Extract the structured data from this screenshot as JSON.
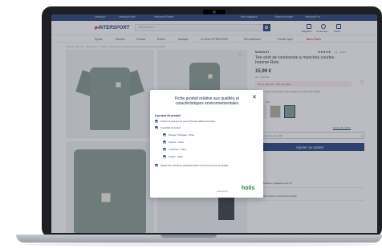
{
  "topbar": {
    "items": [
      "Intersport",
      "Intersport Rent",
      "Intersport Fitness",
      "Mes magasins",
      "Espace membre",
      "Intersport Pro"
    ]
  },
  "header": {
    "logo_text": "INTERSPORT",
    "search_placeholder": "Rechercher...",
    "links": [
      "Magasins",
      "Connexion",
      "Panier"
    ]
  },
  "nav": {
    "items": [
      "Sports",
      "Homme",
      "Femme",
      "Enfant",
      "Marques",
      "Le Team INTERSPORT",
      "Reconditionné",
      "French Days",
      "Bons Plans"
    ]
  },
  "breadcrumb": "Accueil > Homme > Vêtements > T-shirts > Tee-shirt de randonnée à manches courtes homme Relo",
  "product": {
    "brand": "McKINLEY",
    "stars": "★★★★★",
    "reviews": "4.1 · 3 avis",
    "title": "Tee-shirt de randonnée à manches courtes homme Relo",
    "price": "15,99 €",
    "reference": "Réf : 4005290",
    "promo": "Prix le plus bas : Prix Conseillé",
    "payment": "Payez en 3 fois sans frais par carte bancaire dès 100 € avec PayPal",
    "color_label": "Couleur : Vert",
    "size_guide": "Guide des tailles",
    "size_placeholder": "Sélectionnez une taille",
    "add_to_cart": "Ajouter au panier",
    "store_rows": [
      "Retrait en magasin sous 2h",
      "Informations environnementales"
    ]
  },
  "modal": {
    "title": "Fiche produit relative aux qualités et caractéristiques environnementales",
    "section_title": "À propos du produit",
    "rows": [
      "Produit comprenant au moins 57% de matières recyclées",
      "Traçabilité du produit",
      "Tissage / Tricotage : Chine",
      "Teinture : Chine",
      "Confection : Chine",
      "Finition : Chine",
      "Rejette des microfibres plastiques dans l'environnement lors du lavage"
    ],
    "powered_by": "powered by",
    "provider": "holis"
  },
  "colors": {
    "brand_navy": "#0b2b6f",
    "brand_red": "#e3262d",
    "product_green": "#7b8f86",
    "holis_green": "#2f7a4a"
  }
}
